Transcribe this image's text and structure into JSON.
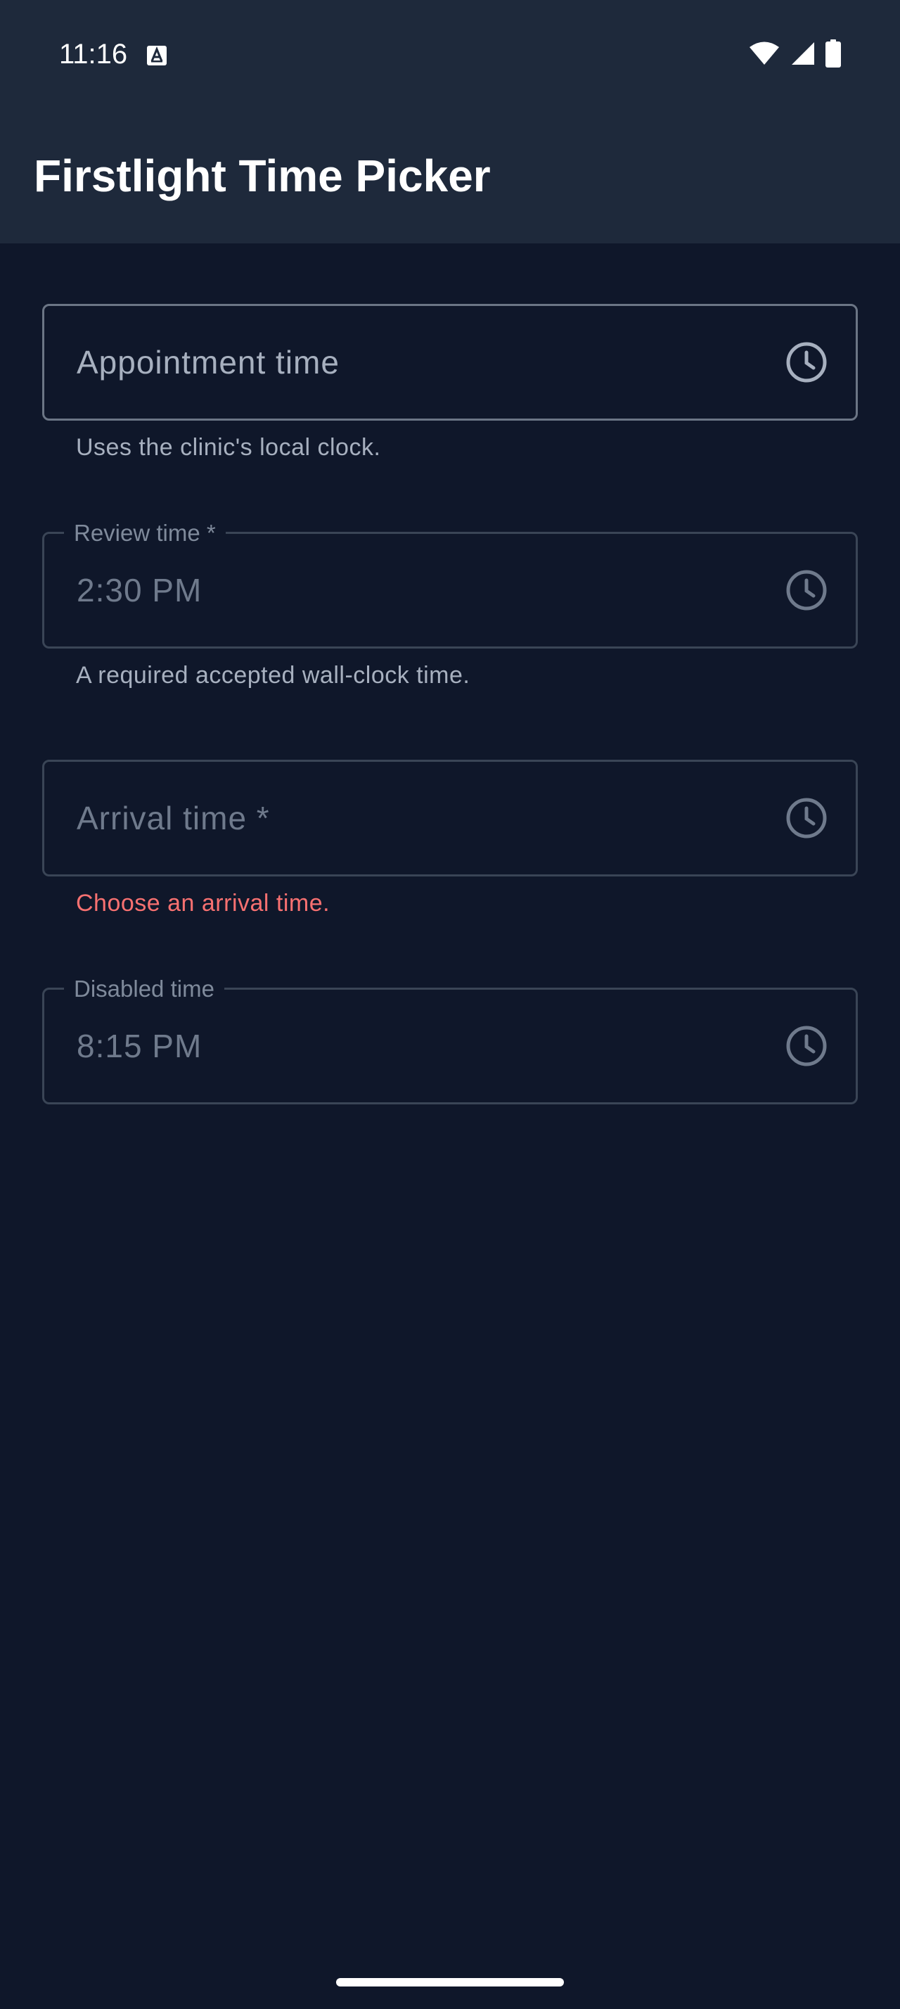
{
  "status_bar": {
    "time": "11:16",
    "icons": [
      "accessibility-notification-icon",
      "wifi-icon",
      "cellular-signal-icon",
      "battery-icon"
    ]
  },
  "app_bar": {
    "title": "Firstlight Time Picker"
  },
  "fields": [
    {
      "label": "Appointment time",
      "value": "",
      "placeholder": "Appointment time",
      "helper": "Uses the clinic's local clock.",
      "state": "default"
    },
    {
      "label": "Review time *",
      "value": "2:30 PM",
      "helper": "A required accepted wall-clock time.",
      "state": "filled"
    },
    {
      "label": "Arrival time *",
      "value": "",
      "placeholder": "Arrival time *",
      "helper": "Choose an arrival time.",
      "state": "error"
    },
    {
      "label": "Disabled time",
      "value": "8:15 PM",
      "state": "disabled"
    }
  ],
  "colors": {
    "background": "#0f172a",
    "app_bar": "#1e293b",
    "error": "#f87171",
    "helper_text": "#a7b0bf",
    "outline": "#6b7585",
    "outline_dim": "#3a4556"
  }
}
